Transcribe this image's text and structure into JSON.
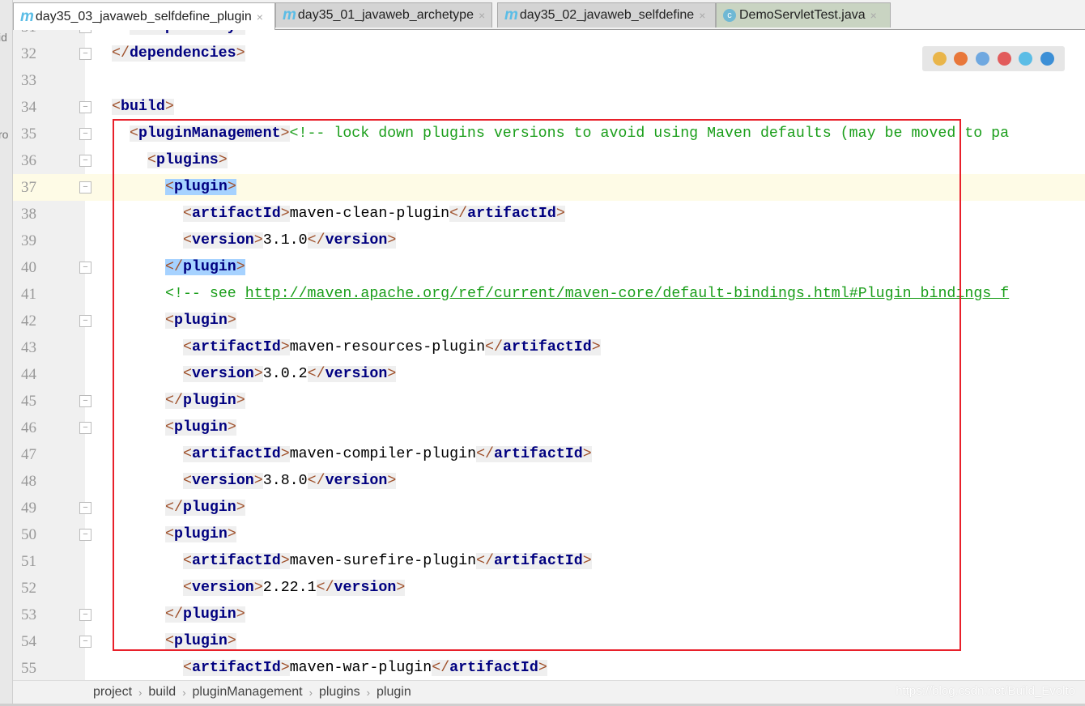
{
  "left_strip": [
    "id",
    "ro"
  ],
  "tabs": [
    {
      "label": "day35_03_javaweb_selfdefine_plugin",
      "icon": "maven-icon",
      "active": true
    },
    {
      "label": "day35_01_javaweb_archetype",
      "icon": "maven-icon"
    },
    {
      "label": "day35_02_javaweb_selfdefine",
      "icon": "maven-icon"
    },
    {
      "label": "DemoServletTest.java",
      "icon": "java-class-icon"
    }
  ],
  "browsers": [
    {
      "name": "chrome-icon",
      "color": "#e9b54a"
    },
    {
      "name": "firefox-icon",
      "color": "#e8773a"
    },
    {
      "name": "safari-icon",
      "color": "#6fa8e0"
    },
    {
      "name": "opera-icon",
      "color": "#e25c5c"
    },
    {
      "name": "ie-icon",
      "color": "#5bbde6"
    },
    {
      "name": "edge-icon",
      "color": "#3c8fd6"
    }
  ],
  "code": {
    "lines": [
      {
        "n": "31",
        "indent": 1,
        "fold": true,
        "tokens": [
          [
            "br",
            "</"
          ],
          [
            "nm",
            "dependency"
          ],
          [
            "br",
            ">"
          ]
        ]
      },
      {
        "n": "32",
        "indent": 0,
        "fold": true,
        "tokens": [
          [
            "br",
            "</"
          ],
          [
            "nm",
            "dependencies"
          ],
          [
            "br",
            ">"
          ]
        ]
      },
      {
        "n": "33",
        "indent": 0,
        "tokens": []
      },
      {
        "n": "34",
        "indent": 0,
        "fold": true,
        "tokens": [
          [
            "br",
            "<"
          ],
          [
            "nm",
            "build"
          ],
          [
            "br",
            ">"
          ]
        ]
      },
      {
        "n": "35",
        "indent": 1,
        "fold": true,
        "tokens": [
          [
            "br",
            "<"
          ],
          [
            "nm",
            "pluginManagement"
          ],
          [
            "br",
            ">"
          ],
          [
            "cm",
            "<!-- lock down plugins versions to avoid using Maven defaults (may be moved to pa"
          ]
        ]
      },
      {
        "n": "36",
        "indent": 2,
        "fold": true,
        "tokens": [
          [
            "br",
            "<"
          ],
          [
            "nm",
            "plugins"
          ],
          [
            "br",
            ">"
          ]
        ]
      },
      {
        "n": "37",
        "indent": 3,
        "fold": true,
        "current": true,
        "sel": true,
        "tokens": [
          [
            "br",
            "<"
          ],
          [
            "nm",
            "plugin"
          ],
          [
            "br",
            ">"
          ]
        ]
      },
      {
        "n": "38",
        "indent": 4,
        "tokens": [
          [
            "br",
            "<"
          ],
          [
            "nm",
            "artifactId"
          ],
          [
            "br",
            ">"
          ],
          [
            "tx",
            "maven-clean-plugin"
          ],
          [
            "br",
            "</"
          ],
          [
            "nm",
            "artifactId"
          ],
          [
            "br",
            ">"
          ]
        ]
      },
      {
        "n": "39",
        "indent": 4,
        "tokens": [
          [
            "br",
            "<"
          ],
          [
            "nm",
            "version"
          ],
          [
            "br",
            ">"
          ],
          [
            "tx",
            "3.1.0"
          ],
          [
            "br",
            "</"
          ],
          [
            "nm",
            "version"
          ],
          [
            "br",
            ">"
          ]
        ]
      },
      {
        "n": "40",
        "indent": 3,
        "fold": true,
        "sel": true,
        "tokens": [
          [
            "br",
            "</"
          ],
          [
            "nm",
            "plugin"
          ],
          [
            "br",
            ">"
          ]
        ]
      },
      {
        "n": "41",
        "indent": 3,
        "tokens": [
          [
            "cm",
            "<!-- see "
          ],
          [
            "lk",
            "http://maven.apache.org/ref/current/maven-core/default-bindings.html#Plugin_bindings_f"
          ]
        ]
      },
      {
        "n": "42",
        "indent": 3,
        "fold": true,
        "tokens": [
          [
            "br",
            "<"
          ],
          [
            "nm",
            "plugin"
          ],
          [
            "br",
            ">"
          ]
        ]
      },
      {
        "n": "43",
        "indent": 4,
        "tokens": [
          [
            "br",
            "<"
          ],
          [
            "nm",
            "artifactId"
          ],
          [
            "br",
            ">"
          ],
          [
            "tx",
            "maven-resources-plugin"
          ],
          [
            "br",
            "</"
          ],
          [
            "nm",
            "artifactId"
          ],
          [
            "br",
            ">"
          ]
        ]
      },
      {
        "n": "44",
        "indent": 4,
        "tokens": [
          [
            "br",
            "<"
          ],
          [
            "nm",
            "version"
          ],
          [
            "br",
            ">"
          ],
          [
            "tx",
            "3.0.2"
          ],
          [
            "br",
            "</"
          ],
          [
            "nm",
            "version"
          ],
          [
            "br",
            ">"
          ]
        ]
      },
      {
        "n": "45",
        "indent": 3,
        "fold": true,
        "tokens": [
          [
            "br",
            "</"
          ],
          [
            "nm",
            "plugin"
          ],
          [
            "br",
            ">"
          ]
        ]
      },
      {
        "n": "46",
        "indent": 3,
        "fold": true,
        "tokens": [
          [
            "br",
            "<"
          ],
          [
            "nm",
            "plugin"
          ],
          [
            "br",
            ">"
          ]
        ]
      },
      {
        "n": "47",
        "indent": 4,
        "tokens": [
          [
            "br",
            "<"
          ],
          [
            "nm",
            "artifactId"
          ],
          [
            "br",
            ">"
          ],
          [
            "tx",
            "maven-compiler-plugin"
          ],
          [
            "br",
            "</"
          ],
          [
            "nm",
            "artifactId"
          ],
          [
            "br",
            ">"
          ]
        ]
      },
      {
        "n": "48",
        "indent": 4,
        "tokens": [
          [
            "br",
            "<"
          ],
          [
            "nm",
            "version"
          ],
          [
            "br",
            ">"
          ],
          [
            "tx",
            "3.8.0"
          ],
          [
            "br",
            "</"
          ],
          [
            "nm",
            "version"
          ],
          [
            "br",
            ">"
          ]
        ]
      },
      {
        "n": "49",
        "indent": 3,
        "fold": true,
        "tokens": [
          [
            "br",
            "</"
          ],
          [
            "nm",
            "plugin"
          ],
          [
            "br",
            ">"
          ]
        ]
      },
      {
        "n": "50",
        "indent": 3,
        "fold": true,
        "tokens": [
          [
            "br",
            "<"
          ],
          [
            "nm",
            "plugin"
          ],
          [
            "br",
            ">"
          ]
        ]
      },
      {
        "n": "51",
        "indent": 4,
        "tokens": [
          [
            "br",
            "<"
          ],
          [
            "nm",
            "artifactId"
          ],
          [
            "br",
            ">"
          ],
          [
            "tx",
            "maven-surefire-plugin"
          ],
          [
            "br",
            "</"
          ],
          [
            "nm",
            "artifactId"
          ],
          [
            "br",
            ">"
          ]
        ]
      },
      {
        "n": "52",
        "indent": 4,
        "tokens": [
          [
            "br",
            "<"
          ],
          [
            "nm",
            "version"
          ],
          [
            "br",
            ">"
          ],
          [
            "tx",
            "2.22.1"
          ],
          [
            "br",
            "</"
          ],
          [
            "nm",
            "version"
          ],
          [
            "br",
            ">"
          ]
        ]
      },
      {
        "n": "53",
        "indent": 3,
        "fold": true,
        "tokens": [
          [
            "br",
            "</"
          ],
          [
            "nm",
            "plugin"
          ],
          [
            "br",
            ">"
          ]
        ]
      },
      {
        "n": "54",
        "indent": 3,
        "fold": true,
        "tokens": [
          [
            "br",
            "<"
          ],
          [
            "nm",
            "plugin"
          ],
          [
            "br",
            ">"
          ]
        ]
      },
      {
        "n": "55",
        "indent": 4,
        "tokens": [
          [
            "br",
            "<"
          ],
          [
            "nm",
            "artifactId"
          ],
          [
            "br",
            ">"
          ],
          [
            "tx",
            "maven-war-plugin"
          ],
          [
            "br",
            "</"
          ],
          [
            "nm",
            "artifactId"
          ],
          [
            "br",
            ">"
          ]
        ]
      }
    ]
  },
  "breadcrumb": [
    "project",
    "build",
    "pluginManagement",
    "plugins",
    "plugin"
  ],
  "breadcrumb_separator": "›",
  "watermark": "https://blog.csdn.net/Build_Evolto",
  "highlight_color": "#e8202a"
}
